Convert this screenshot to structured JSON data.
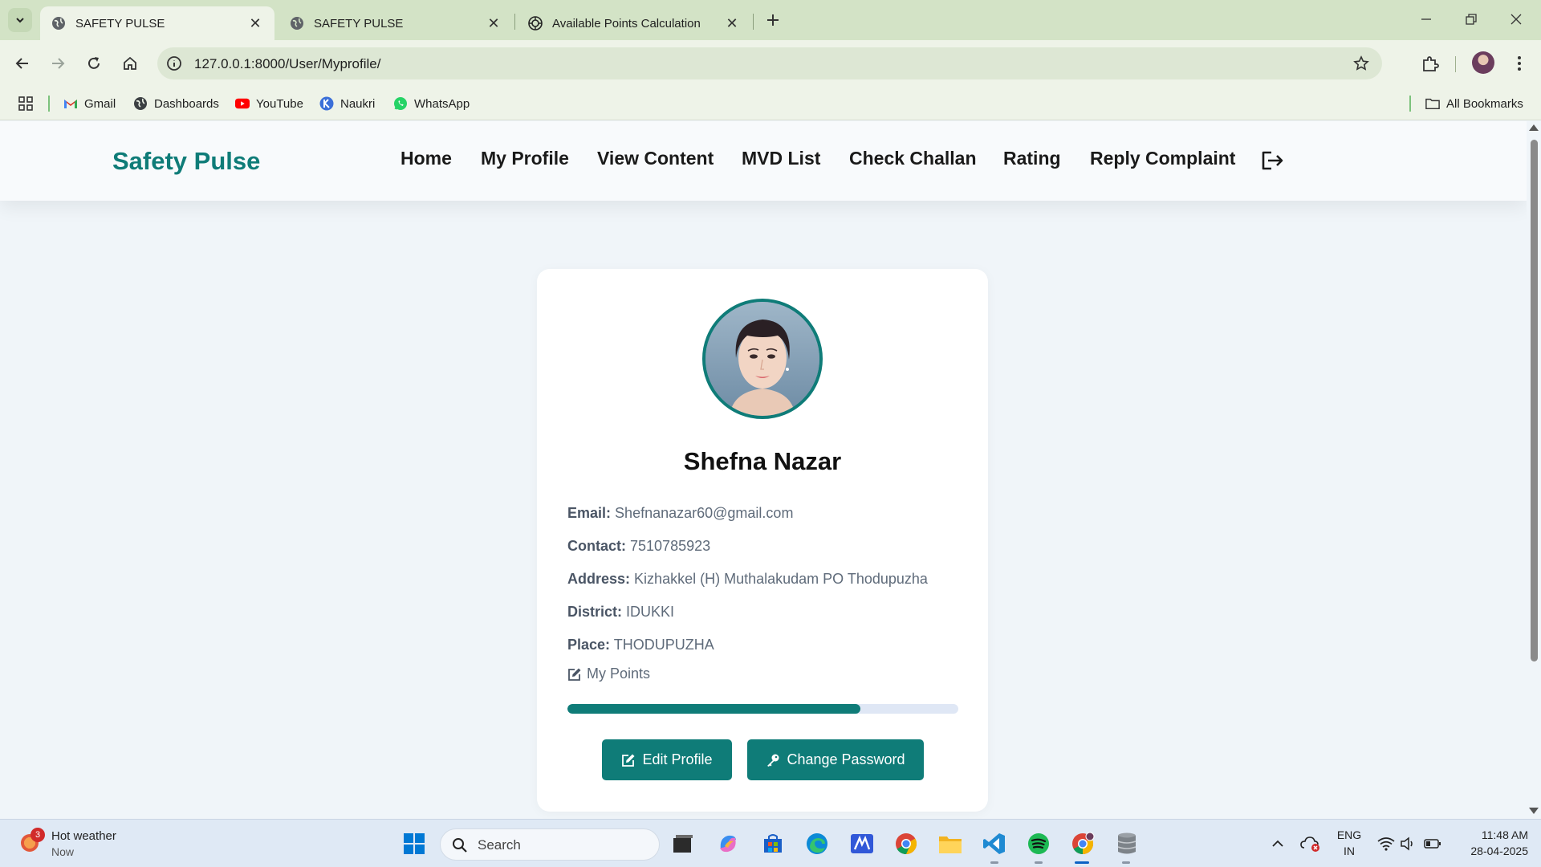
{
  "browser": {
    "tabs": [
      {
        "title": "SAFETY PULSE",
        "active": true,
        "icon": "globe-icon"
      },
      {
        "title": "SAFETY PULSE",
        "active": false,
        "icon": "globe-icon"
      },
      {
        "title": "Available Points Calculation",
        "active": false,
        "icon": "openai-icon"
      }
    ],
    "url": "127.0.0.1:8000/User/Myprofile/",
    "bookmarks": [
      {
        "label": "Gmail",
        "icon": "gmail-icon"
      },
      {
        "label": "Dashboards",
        "icon": "globe-icon"
      },
      {
        "label": "YouTube",
        "icon": "youtube-icon"
      },
      {
        "label": "Naukri",
        "icon": "naukri-icon"
      },
      {
        "label": "WhatsApp",
        "icon": "whatsapp-icon"
      }
    ],
    "all_bookmarks": "All Bookmarks"
  },
  "site": {
    "brand": "Safety Pulse",
    "brand_color": "#0f7c78",
    "nav": [
      "Home",
      "My Profile",
      "View Content",
      "MVD List",
      "Check Challan",
      "Rating",
      "Reply Complaint"
    ],
    "logout_icon": "logout-icon"
  },
  "profile": {
    "name": "Shefna Nazar",
    "fields": [
      {
        "label": "Email:",
        "value": "Shefnanazar60@gmail.com"
      },
      {
        "label": "Contact:",
        "value": "7510785923"
      },
      {
        "label": "Address:",
        "value": "Kizhakkel (H) Muthalakudam PO Thodupuzha"
      },
      {
        "label": "District:",
        "value": "IDUKKI"
      },
      {
        "label": "Place:",
        "value": "THODUPUZHA"
      }
    ],
    "points_label": "My Points",
    "points_progress_percent": 75,
    "edit_button": "Edit Profile",
    "password_button": "Change Password"
  },
  "taskbar": {
    "weather_title": "Hot weather",
    "weather_sub": "Now",
    "weather_badge": "3",
    "search_placeholder": "Search",
    "lang_top": "ENG",
    "lang_bottom": "IN",
    "time": "11:48 AM",
    "date": "28-04-2025"
  }
}
